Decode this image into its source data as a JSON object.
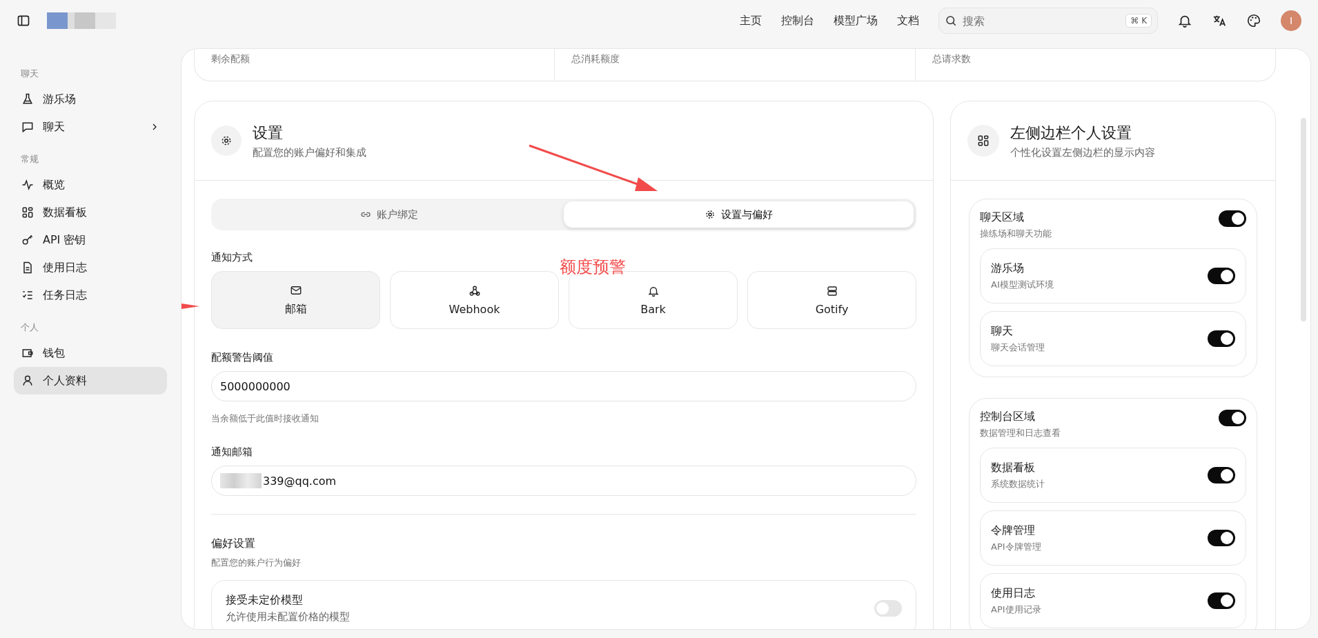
{
  "header": {
    "nav": [
      {
        "label": "主页"
      },
      {
        "label": "控制台"
      },
      {
        "label": "模型广场"
      },
      {
        "label": "文档"
      }
    ],
    "search": {
      "placeholder": "搜索",
      "shortcut": "⌘ K"
    },
    "avatar": "I"
  },
  "sidebar": {
    "sections": [
      {
        "title": "聊天",
        "items": [
          {
            "label": "游乐场",
            "selected": false,
            "expandable": false
          },
          {
            "label": "聊天",
            "selected": false,
            "expandable": true
          }
        ]
      },
      {
        "title": "常规",
        "items": [
          {
            "label": "概览",
            "selected": false,
            "expandable": false
          },
          {
            "label": "数据看板",
            "selected": false,
            "expandable": false
          },
          {
            "label": "API 密钥",
            "selected": false,
            "expandable": false
          },
          {
            "label": "使用日志",
            "selected": false,
            "expandable": false
          },
          {
            "label": "任务日志",
            "selected": false,
            "expandable": false
          }
        ]
      },
      {
        "title": "个人",
        "items": [
          {
            "label": "钱包",
            "selected": false,
            "expandable": false
          },
          {
            "label": "个人资料",
            "selected": true,
            "expandable": false
          }
        ]
      }
    ]
  },
  "stats": [
    "剩余配额",
    "总消耗额度",
    "总请求数"
  ],
  "settings": {
    "title": "设置",
    "subtitle": "配置您的账户偏好和集成",
    "tabs": [
      {
        "label": "账户绑定",
        "selected": false
      },
      {
        "label": "设置与偏好",
        "selected": true
      }
    ],
    "notify_label": "通知方式",
    "methods": [
      {
        "label": "邮箱",
        "selected": true
      },
      {
        "label": "Webhook",
        "selected": false
      },
      {
        "label": "Bark",
        "selected": false
      },
      {
        "label": "Gotify",
        "selected": false
      }
    ],
    "threshold": {
      "label": "配额警告阈值",
      "value": "5000000000",
      "hint": "当余额低于此值时接收通知"
    },
    "email": {
      "label": "通知邮箱",
      "value": "339@qq.com"
    },
    "preferences": {
      "title": "偏好设置",
      "subtitle": "配置您的账户行为偏好",
      "items": [
        {
          "title": "接受未定价模型",
          "desc": "允许使用未配置价格的模型",
          "on": false
        }
      ]
    }
  },
  "sidebar_settings": {
    "title": "左侧边栏个人设置",
    "subtitle": "个性化设置左侧边栏的显示内容",
    "groups": [
      {
        "title": "聊天区域",
        "desc": "操练场和聊天功能",
        "on": true,
        "items": [
          {
            "title": "游乐场",
            "desc": "AI模型测试环境",
            "on": true
          },
          {
            "title": "聊天",
            "desc": "聊天会话管理",
            "on": true
          }
        ]
      },
      {
        "title": "控制台区域",
        "desc": "数据管理和日志查看",
        "on": true,
        "items": [
          {
            "title": "数据看板",
            "desc": "系统数据统计",
            "on": true
          },
          {
            "title": "令牌管理",
            "desc": "API令牌管理",
            "on": true
          },
          {
            "title": "使用日志",
            "desc": "API使用记录",
            "on": true
          }
        ]
      }
    ]
  },
  "annotation": "额度预警"
}
